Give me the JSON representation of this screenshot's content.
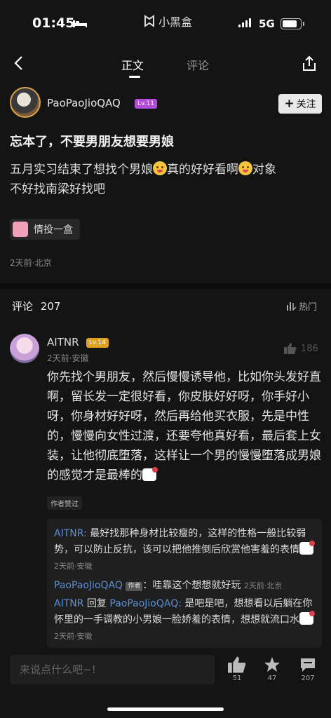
{
  "status_bar": {
    "time": "01:45",
    "app_name": "小黑盒",
    "network": "5G"
  },
  "nav": {
    "tabs": [
      {
        "label": "正文"
      },
      {
        "label": "评论"
      }
    ]
  },
  "post": {
    "author": {
      "name": "PaoPaoJioQAQ",
      "level": "Lv.11",
      "level_color": "#b04cd8"
    },
    "follow_label": "关注",
    "title": "忘本了，不要男朋友想要男娘",
    "body_line1_a": "五月实习结束了想找个男娘",
    "body_line1_b": "真的好好看啊",
    "body_line1_c": "对象",
    "body_line2": "不好找南梁好找吧",
    "topic": "情投一盒",
    "meta": "2天前·北京"
  },
  "comments": {
    "title": "评论",
    "count": "207",
    "sort_label": "热门",
    "items": [
      {
        "name": "AITNR",
        "level": "Lv.14",
        "level_color": "#e0a020",
        "meta": "2天前·安徽",
        "likes": "186",
        "text": "你先找个男朋友，然后慢慢诱导他，比如你头发好直啊，留长发一定很好看，你皮肤好好呀，你手好小呀，你身材好好呀，然后再给他买衣服，先是中性的，慢慢向女性过渡，还要夸他真好看，最后套上女装，让他彻底堕落，这样让一个男的慢慢堕落成男娘的感觉才是最棒的",
        "liked_by_author": "作者赞过",
        "replies": [
          {
            "name": "AITNR:",
            "text": " 最好找那种身材比较瘦的，这样的性格一般比较弱势，可以防止反抗，该可以把他推倒后欣赏他害羞的表情",
            "meta": "2天前·安徽"
          },
          {
            "name": "PaoPaoJioQAQ",
            "author_tag": "作者",
            "text": "：哇靠这个想想就好玩",
            "meta": "2天前·北京"
          },
          {
            "name": "AITNR",
            "reply_word": " 回复 ",
            "target": "PaoPaoJioQAQ:",
            "text": " 是吧是吧，想想看以后躺在你怀里的一手调教的小男娘一脸娇羞的表情，想想就流口水",
            "meta": "2天前·安徽"
          }
        ]
      }
    ]
  },
  "bottom_bar": {
    "input_placeholder": "来说点什么吧~!",
    "likes": "51",
    "stars": "47",
    "comments": "207"
  }
}
